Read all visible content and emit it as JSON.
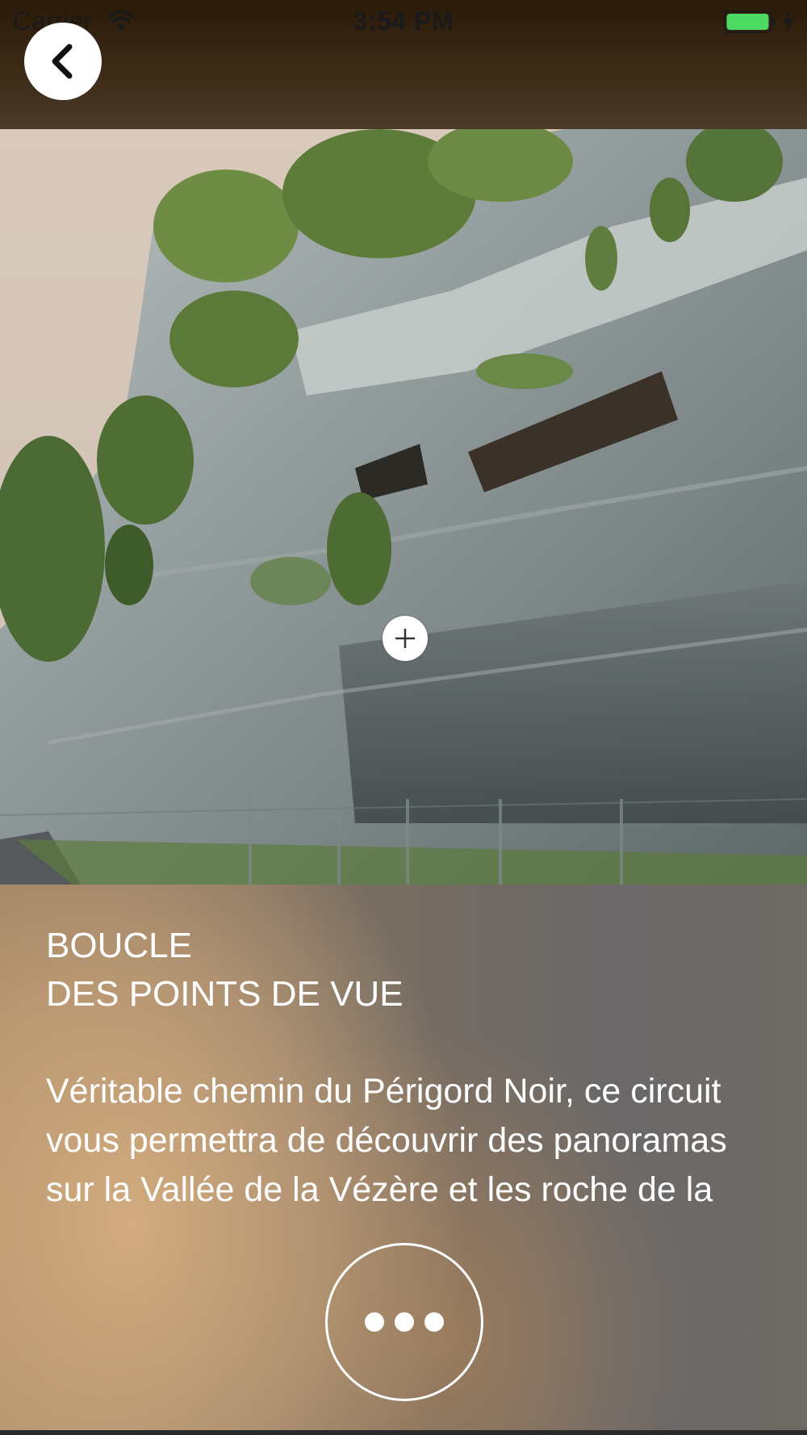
{
  "status_bar": {
    "carrier": "Carrier",
    "time": "3:54 PM",
    "wifi_icon": "wifi-icon",
    "battery_icon": "battery-icon",
    "charging_icon": "charging-bolt-icon",
    "battery_color": "#4cd964"
  },
  "nav": {
    "back_icon": "chevron-left-icon"
  },
  "hero": {
    "zoom_icon": "plus-icon"
  },
  "route": {
    "title_line_1": "BOUCLE",
    "title_line_2": "DES POINTS DE VUE",
    "description": "Véritable chemin du Périgord Noir, ce circuit vous permettra de découvrir des panoramas sur la Vallée de la Vézère et les roche de la Pie des..."
  },
  "actions": {
    "more_icon": "more-dots-icon"
  },
  "colors": {
    "header_dark": "#2a1a08",
    "text_light": "#ffffff"
  }
}
